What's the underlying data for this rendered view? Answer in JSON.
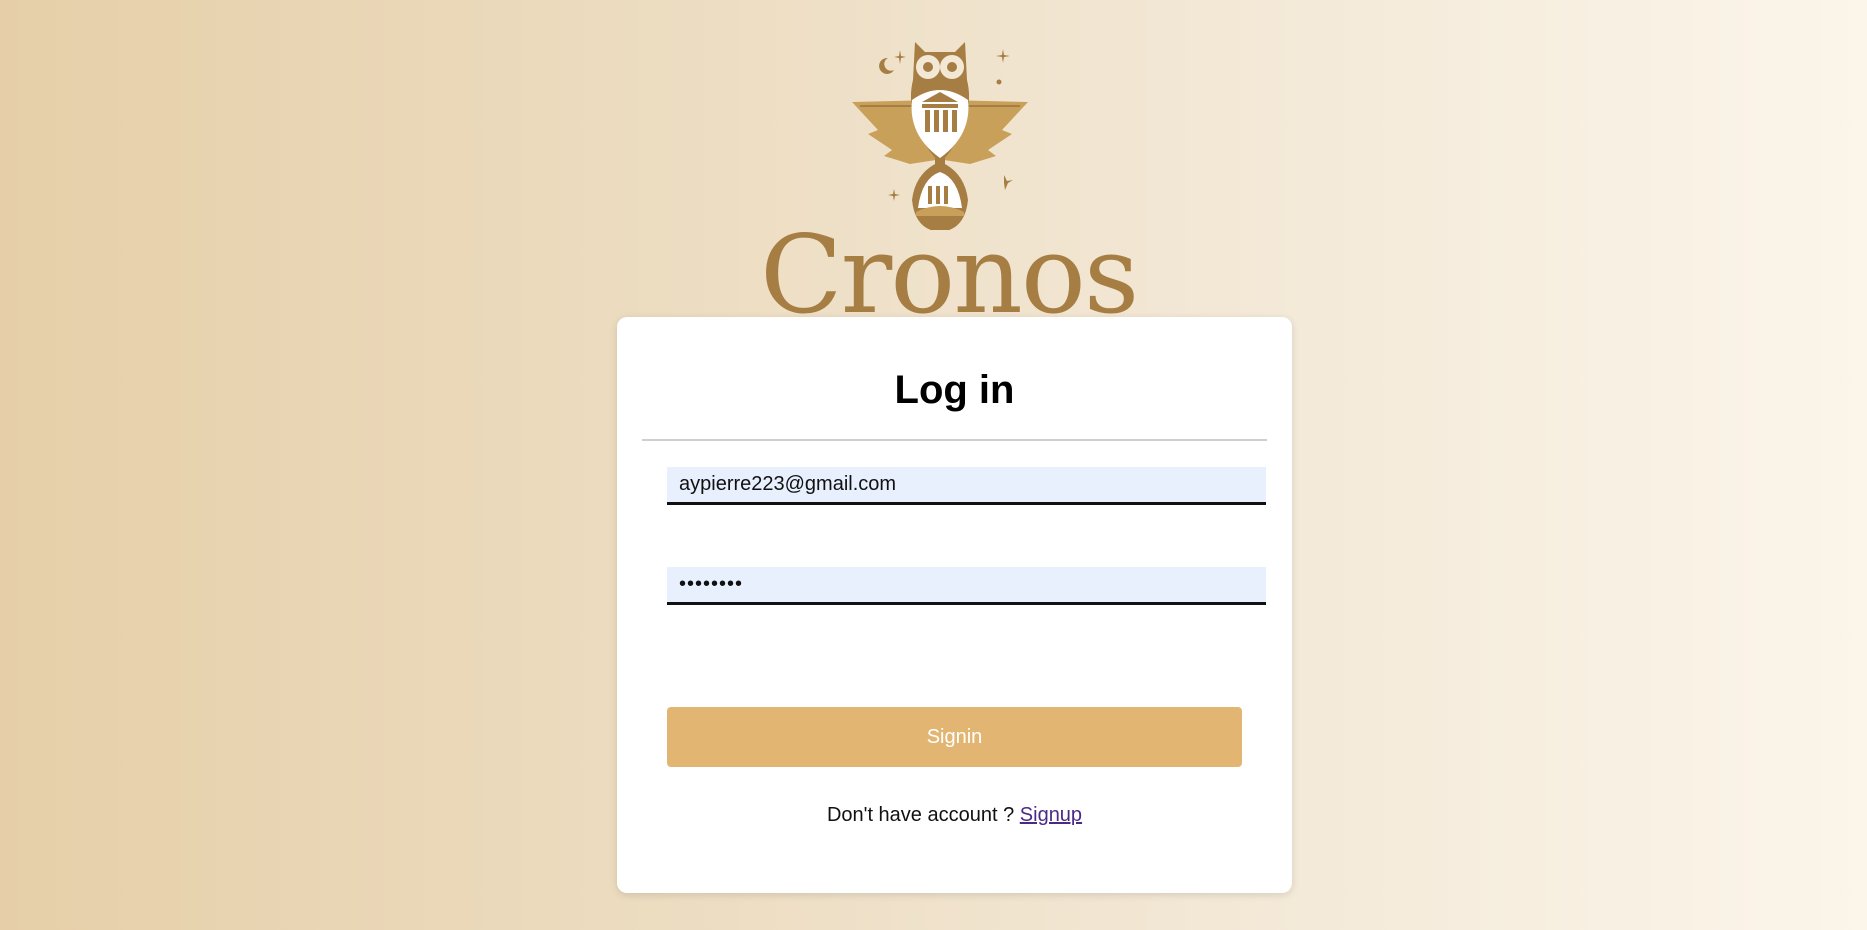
{
  "brand": {
    "name": "Cronos",
    "logo_icon": "owl-hourglass-emblem",
    "color": "#a67e44",
    "accent": "#c9a05a"
  },
  "login": {
    "title": "Log in",
    "email_value": "aypierre223@gmail.com",
    "password_value": "password",
    "signin_label": "Signin",
    "no_account_text": "Don't have account ?",
    "signup_label": "Signup"
  },
  "colors": {
    "button": "#e2b672",
    "input_bg": "#e8f0fe",
    "link": "#4b2a86"
  }
}
